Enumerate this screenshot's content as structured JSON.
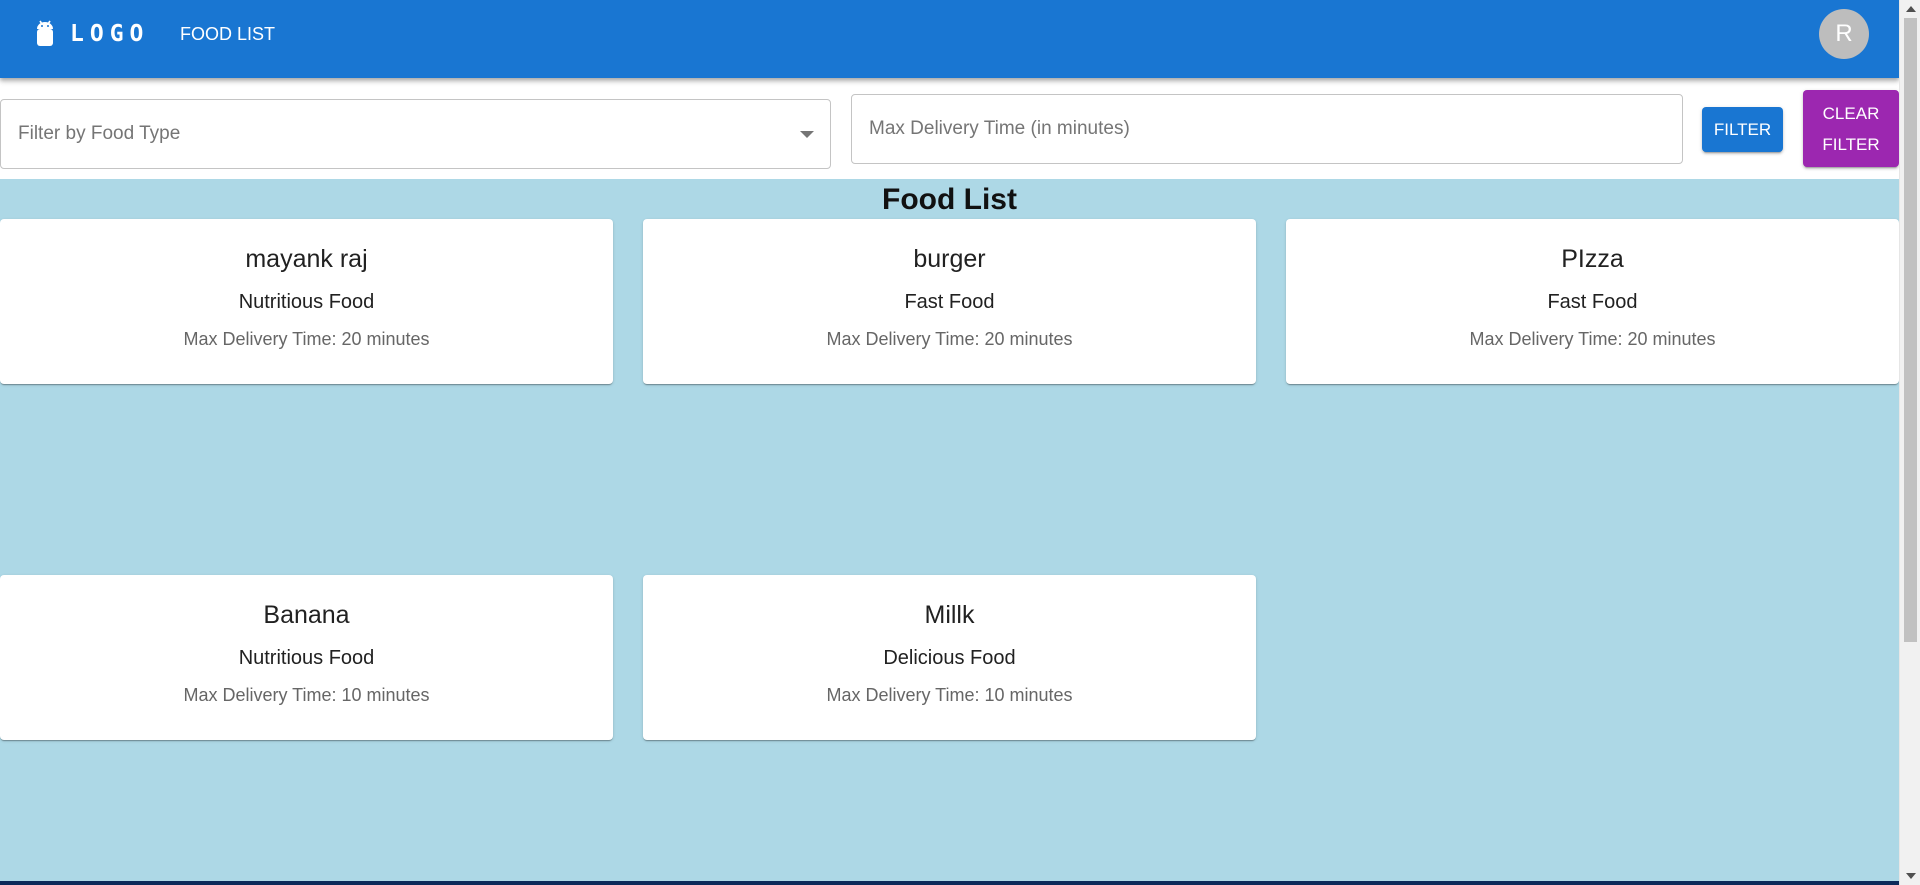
{
  "appbar": {
    "logo_text": "LOGO",
    "logo_icon": "android-icon",
    "nav_link": "FOOD LIST",
    "avatar_initial": "R",
    "color": "#1976d2"
  },
  "filters": {
    "food_type_placeholder": "Filter by Food Type",
    "max_delivery_placeholder": "Max Delivery Time (in minutes)",
    "filter_button": "FILTER",
    "clear_button": "CLEAR FILTER",
    "filter_color": "#1976d2",
    "clear_color": "#9c27b0"
  },
  "main": {
    "title": "Food List",
    "background": "#add8e6",
    "foods": [
      {
        "name": "mayank raj",
        "type": "Nutritious Food",
        "delivery": "Max Delivery Time: 20 minutes"
      },
      {
        "name": "burger",
        "type": "Fast Food",
        "delivery": "Max Delivery Time: 20 minutes"
      },
      {
        "name": "PIzza",
        "type": "Fast Food",
        "delivery": "Max Delivery Time: 20 minutes"
      },
      {
        "name": "Banana",
        "type": "Nutritious Food",
        "delivery": "Max Delivery Time: 10 minutes"
      },
      {
        "name": "Millk",
        "type": "Delicious Food",
        "delivery": "Max Delivery Time: 10 minutes"
      }
    ]
  }
}
